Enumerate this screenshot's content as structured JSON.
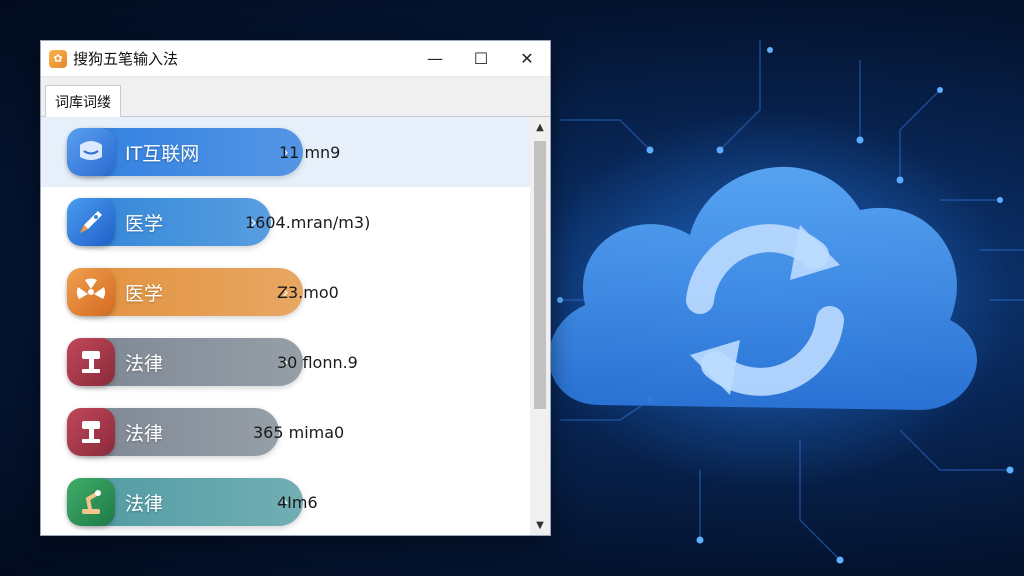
{
  "window": {
    "title": "搜狗五笔输入法",
    "controls": {
      "minimize": "—",
      "maximize": "☐",
      "close": "✕"
    }
  },
  "tabs": [
    {
      "label": "词库词缕"
    }
  ],
  "list": {
    "items": [
      {
        "label": "IT互联网",
        "count": "11 mn9",
        "icon": "chat-bubble-icon",
        "color": "#2f7fe0",
        "chevron": "›",
        "selected": true
      },
      {
        "label": "医学",
        "count": "1604.mran/m3)",
        "icon": "rocket-icon",
        "color": "#2f85d8",
        "chevron": "›",
        "selected": false
      },
      {
        "label": "医学",
        "count": "Z3.mo0",
        "icon": "radiation-icon",
        "color": "#e2913c",
        "chevron": "›",
        "selected": false
      },
      {
        "label": "法律",
        "count": "30 flonn.9",
        "icon": "gavel-icon",
        "color": "#7c8692",
        "chevron": "›",
        "selected": false
      },
      {
        "label": "法律",
        "count": "365 mima0",
        "icon": "gavel-icon",
        "color": "#7c8692",
        "chevron": "",
        "selected": false
      },
      {
        "label": "法律",
        "count": "4Im6",
        "icon": "robot-arm-icon",
        "color": "#4f9aa2",
        "chevron": "›",
        "selected": false
      }
    ]
  },
  "scrollbar": {
    "up": "▲",
    "down": "▼"
  },
  "background": {
    "icon": "cloud-sync-icon"
  }
}
